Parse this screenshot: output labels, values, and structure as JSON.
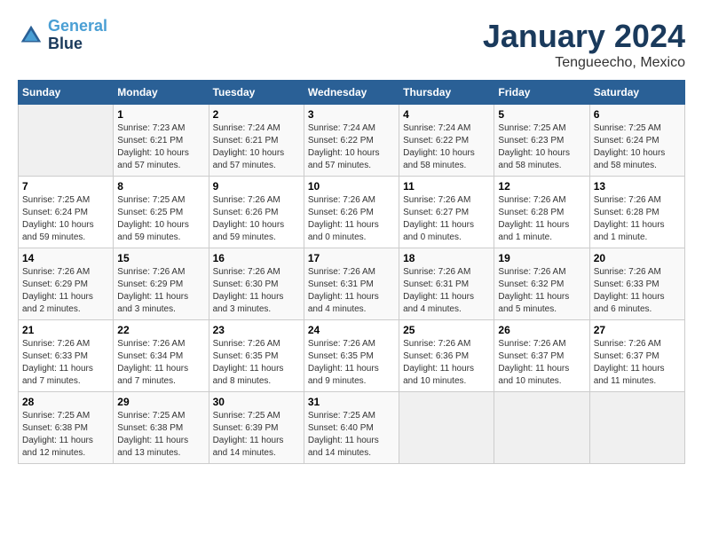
{
  "header": {
    "logo_line1": "General",
    "logo_line2": "Blue",
    "month": "January 2024",
    "location": "Tengueecho, Mexico"
  },
  "weekdays": [
    "Sunday",
    "Monday",
    "Tuesday",
    "Wednesday",
    "Thursday",
    "Friday",
    "Saturday"
  ],
  "weeks": [
    [
      {
        "day": "",
        "info": ""
      },
      {
        "day": "1",
        "info": "Sunrise: 7:23 AM\nSunset: 6:21 PM\nDaylight: 10 hours\nand 57 minutes."
      },
      {
        "day": "2",
        "info": "Sunrise: 7:24 AM\nSunset: 6:21 PM\nDaylight: 10 hours\nand 57 minutes."
      },
      {
        "day": "3",
        "info": "Sunrise: 7:24 AM\nSunset: 6:22 PM\nDaylight: 10 hours\nand 57 minutes."
      },
      {
        "day": "4",
        "info": "Sunrise: 7:24 AM\nSunset: 6:22 PM\nDaylight: 10 hours\nand 58 minutes."
      },
      {
        "day": "5",
        "info": "Sunrise: 7:25 AM\nSunset: 6:23 PM\nDaylight: 10 hours\nand 58 minutes."
      },
      {
        "day": "6",
        "info": "Sunrise: 7:25 AM\nSunset: 6:24 PM\nDaylight: 10 hours\nand 58 minutes."
      }
    ],
    [
      {
        "day": "7",
        "info": "Sunrise: 7:25 AM\nSunset: 6:24 PM\nDaylight: 10 hours\nand 59 minutes."
      },
      {
        "day": "8",
        "info": "Sunrise: 7:25 AM\nSunset: 6:25 PM\nDaylight: 10 hours\nand 59 minutes."
      },
      {
        "day": "9",
        "info": "Sunrise: 7:26 AM\nSunset: 6:26 PM\nDaylight: 10 hours\nand 59 minutes."
      },
      {
        "day": "10",
        "info": "Sunrise: 7:26 AM\nSunset: 6:26 PM\nDaylight: 11 hours\nand 0 minutes."
      },
      {
        "day": "11",
        "info": "Sunrise: 7:26 AM\nSunset: 6:27 PM\nDaylight: 11 hours\nand 0 minutes."
      },
      {
        "day": "12",
        "info": "Sunrise: 7:26 AM\nSunset: 6:28 PM\nDaylight: 11 hours\nand 1 minute."
      },
      {
        "day": "13",
        "info": "Sunrise: 7:26 AM\nSunset: 6:28 PM\nDaylight: 11 hours\nand 1 minute."
      }
    ],
    [
      {
        "day": "14",
        "info": "Sunrise: 7:26 AM\nSunset: 6:29 PM\nDaylight: 11 hours\nand 2 minutes."
      },
      {
        "day": "15",
        "info": "Sunrise: 7:26 AM\nSunset: 6:29 PM\nDaylight: 11 hours\nand 3 minutes."
      },
      {
        "day": "16",
        "info": "Sunrise: 7:26 AM\nSunset: 6:30 PM\nDaylight: 11 hours\nand 3 minutes."
      },
      {
        "day": "17",
        "info": "Sunrise: 7:26 AM\nSunset: 6:31 PM\nDaylight: 11 hours\nand 4 minutes."
      },
      {
        "day": "18",
        "info": "Sunrise: 7:26 AM\nSunset: 6:31 PM\nDaylight: 11 hours\nand 4 minutes."
      },
      {
        "day": "19",
        "info": "Sunrise: 7:26 AM\nSunset: 6:32 PM\nDaylight: 11 hours\nand 5 minutes."
      },
      {
        "day": "20",
        "info": "Sunrise: 7:26 AM\nSunset: 6:33 PM\nDaylight: 11 hours\nand 6 minutes."
      }
    ],
    [
      {
        "day": "21",
        "info": "Sunrise: 7:26 AM\nSunset: 6:33 PM\nDaylight: 11 hours\nand 7 minutes."
      },
      {
        "day": "22",
        "info": "Sunrise: 7:26 AM\nSunset: 6:34 PM\nDaylight: 11 hours\nand 7 minutes."
      },
      {
        "day": "23",
        "info": "Sunrise: 7:26 AM\nSunset: 6:35 PM\nDaylight: 11 hours\nand 8 minutes."
      },
      {
        "day": "24",
        "info": "Sunrise: 7:26 AM\nSunset: 6:35 PM\nDaylight: 11 hours\nand 9 minutes."
      },
      {
        "day": "25",
        "info": "Sunrise: 7:26 AM\nSunset: 6:36 PM\nDaylight: 11 hours\nand 10 minutes."
      },
      {
        "day": "26",
        "info": "Sunrise: 7:26 AM\nSunset: 6:37 PM\nDaylight: 11 hours\nand 10 minutes."
      },
      {
        "day": "27",
        "info": "Sunrise: 7:26 AM\nSunset: 6:37 PM\nDaylight: 11 hours\nand 11 minutes."
      }
    ],
    [
      {
        "day": "28",
        "info": "Sunrise: 7:25 AM\nSunset: 6:38 PM\nDaylight: 11 hours\nand 12 minutes."
      },
      {
        "day": "29",
        "info": "Sunrise: 7:25 AM\nSunset: 6:38 PM\nDaylight: 11 hours\nand 13 minutes."
      },
      {
        "day": "30",
        "info": "Sunrise: 7:25 AM\nSunset: 6:39 PM\nDaylight: 11 hours\nand 14 minutes."
      },
      {
        "day": "31",
        "info": "Sunrise: 7:25 AM\nSunset: 6:40 PM\nDaylight: 11 hours\nand 14 minutes."
      },
      {
        "day": "",
        "info": ""
      },
      {
        "day": "",
        "info": ""
      },
      {
        "day": "",
        "info": ""
      }
    ]
  ]
}
